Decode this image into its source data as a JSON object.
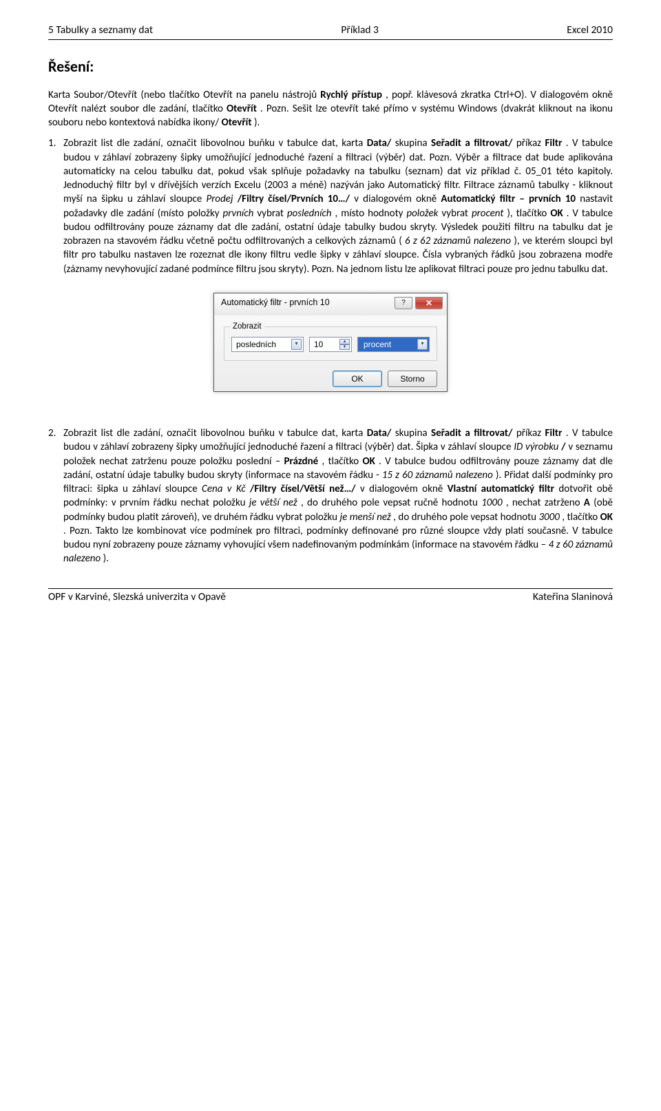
{
  "header": {
    "left": "5 Tabulky a seznamy dat",
    "center": "Příklad 3",
    "right": "Excel 2010"
  },
  "solution_heading": "Řešení:",
  "intro": {
    "t1": "Karta Soubor/Otevřít (nebo tlačítko Otevřít na panelu nástrojů ",
    "t2": "Rychlý přístup",
    "t3": ", popř. klávesová zkratka Ctrl+O). V dialogovém okně Otevřít nalézt soubor dle zadání, tlačítko ",
    "t4": "Otevřít",
    "t5": ". Pozn. Sešit lze otevřít také přímo v systému Windows (dvakrát kliknout na ikonu souboru nebo kontextová nabídka ikony/",
    "t6": "Otevřít",
    "t7": ")."
  },
  "item1": {
    "a": "Zobrazit list dle zadání, označit libovolnou buňku v tabulce dat, karta ",
    "b": "Data/",
    "c": "skupina ",
    "d": "Seřadit a filtrovat/",
    "e": "příkaz ",
    "f": "Filtr",
    "g": ". V tabulce budou v záhlaví zobrazeny šipky umožňující jednoduché řazení a filtraci (výběr) dat. Pozn. Výběr a filtrace dat bude aplikována automaticky na celou tabulku dat, pokud však splňuje požadavky na tabulku (seznam) dat viz příklad č. 05_01 této kapitoly. Jednoduchý filtr byl v dřívějších verzích Excelu (2003 a méně) nazýván jako Automatický filtr. Filtrace záznamů tabulky - kliknout myší na šipku u záhlaví sloupce ",
    "h": "Prodej",
    "i": "/Filtry čísel/Prvních 10…/",
    "j": "v dialogovém okně ",
    "k": "Automatický filtr – prvních 10",
    "l": " nastavit požadavky dle zadání (místo položky ",
    "m": "prvních",
    "n": " vybrat ",
    "o": "posledních",
    "p": ", místo hodnoty ",
    "q": "položek",
    "r": " vybrat ",
    "s": "procent",
    "t": "), tlačítko ",
    "u": "OK",
    "v": ". V tabulce budou odfiltrovány pouze záznamy dat dle zadání, ostatní údaje tabulky budou skryty. Výsledek použití filtru na tabulku dat je zobrazen na stavovém řádku včetně počtu odfiltrovaných a celkových záznamů (",
    "w": "6 z 62 záznamů nalezeno",
    "x": "), ve kterém sloupci byl filtr pro tabulku nastaven lze rozeznat dle ikony filtru vedle šipky v záhlaví sloupce. Čísla vybraných řádků jsou zobrazena modře (záznamy nevyhovující zadané podmínce filtru jsou skryty). Pozn. Na jednom listu lze aplikovat filtraci pouze pro jednu tabulku dat."
  },
  "dialog": {
    "title": "Automatický filtr - prvních 10",
    "help_icon": "?",
    "close_icon": "✕",
    "group_label": "Zobrazit",
    "combo1": "posledních",
    "spin_value": "10",
    "spin_up": "▲",
    "spin_down": "▼",
    "combo2": "procent",
    "ok": "OK",
    "cancel": "Storno"
  },
  "item2": {
    "a": "Zobrazit list dle zadání, označit libovolnou buňku v tabulce dat, karta ",
    "b": "Data/",
    "c": "skupina ",
    "d": "Seřadit a filtrovat/",
    "e": "příkaz ",
    "f": "Filtr",
    "g": ". V tabulce budou v záhlaví zobrazeny šipky umožňující jednoduché řazení a filtraci (výběr) dat. Šipka v záhlaví sloupce ",
    "h": "ID výrobku",
    "i": "/",
    "j": "v seznamu položek nechat zatrženu pouze položku poslední – ",
    "k": "Prázdné",
    "l": ", tlačítko ",
    "m": "OK",
    "n": ". V tabulce budou odfiltrovány pouze záznamy dat dle zadání, ostatní údaje tabulky budou skryty (informace na stavovém řádku - ",
    "o": "15 z 60 záznamů nalezeno",
    "p": "). Přidat další podmínky pro filtraci: šipka u záhlaví sloupce ",
    "q": "Cena v Kč",
    "r": "/Filtry čísel/Větší než…/",
    "s": "v dialogovém okně ",
    "t": "Vlastní automatický filtr",
    "u": " dotvořit obě podmínky: v prvním řádku nechat položku ",
    "v": "je větší než",
    "w": ", do druhého pole vepsat ručně hodnotu ",
    "x": "1000",
    "y": ", nechat zatrženo ",
    "z": "A",
    "aa": " (obě podmínky budou platit zároveň), ve druhém řádku vybrat položku ",
    "ab": "je menší než",
    "ac": ", do druhého pole vepsat hodnotu ",
    "ad": "3000",
    "ae": ", tlačítko ",
    "af": "OK",
    "ag": ". Pozn. Takto lze kombinovat více podmínek pro filtraci, podmínky definované pro různé sloupce vždy platí současně. V tabulce budou nyní zobrazeny pouze záznamy vyhovující všem nadefinovaným podmínkám (informace na stavovém řádku – ",
    "ah": "4 z 60 záznamů nalezeno",
    "ai": ")."
  },
  "footer": {
    "left": "OPF v Karviné, Slezská univerzita v Opavě",
    "right": "Kateřina Slaninová"
  }
}
